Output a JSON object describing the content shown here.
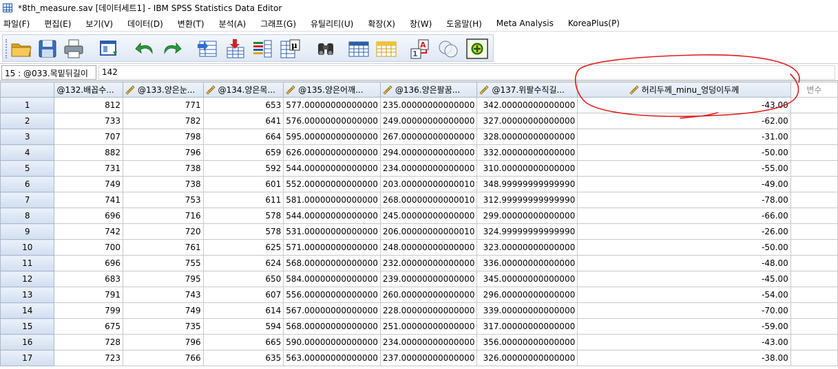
{
  "window": {
    "title": "*8th_measure.sav [데이터세트1] - IBM SPSS Statistics Data Editor"
  },
  "menu": [
    "파일(F)",
    "편집(E)",
    "보기(V)",
    "데이터(D)",
    "변환(T)",
    "분석(A)",
    "그래프(G)",
    "유틸리티(U)",
    "확장(X)",
    "창(W)",
    "도움말(H)",
    "Meta Analysis",
    "KoreaPlus(P)"
  ],
  "toolbar": {
    "icons": [
      "open-folder-icon",
      "save-icon",
      "print-icon",
      "recall-dialog-icon",
      "undo-icon",
      "redo-icon",
      "goto-case-icon",
      "goto-variable-icon",
      "variables-icon",
      "value-labels-mu-icon",
      "find-binoculars-icon",
      "insert-cases-icon",
      "insert-variable-icon",
      "split-file-icon",
      "weight-cases-icon",
      "select-cases-icon",
      "use-sets-icon"
    ]
  },
  "cellbar": {
    "ref": "15 : @033.목밑뒤길이",
    "value": "142"
  },
  "grid": {
    "columns": [
      {
        "label": "@132.배꼽수...",
        "ruler": false
      },
      {
        "label": "@133.양은눈...",
        "ruler": true
      },
      {
        "label": "@134.양은목...",
        "ruler": true
      },
      {
        "label": "@135.양은어깨...",
        "ruler": true
      },
      {
        "label": "@136.양은팔꿈...",
        "ruler": true
      },
      {
        "label": "@137.위팔수직길...",
        "ruler": true
      },
      {
        "label": "허리두께_minu_엉덩이두께",
        "ruler": true
      }
    ],
    "empty_column_label": "변수",
    "rows": [
      {
        "n": "1",
        "c": [
          "812",
          "771",
          "653",
          "577.00000000000000",
          "235.00000000000000",
          "342.00000000000000",
          "-43.00"
        ]
      },
      {
        "n": "2",
        "c": [
          "733",
          "782",
          "641",
          "576.00000000000000",
          "249.00000000000000",
          "327.00000000000000",
          "-62.00"
        ]
      },
      {
        "n": "3",
        "c": [
          "707",
          "798",
          "664",
          "595.00000000000000",
          "267.00000000000000",
          "328.00000000000000",
          "-31.00"
        ]
      },
      {
        "n": "4",
        "c": [
          "882",
          "796",
          "659",
          "626.00000000000000",
          "294.00000000000000",
          "332.00000000000000",
          "-50.00"
        ]
      },
      {
        "n": "5",
        "c": [
          "731",
          "738",
          "592",
          "544.00000000000000",
          "234.00000000000000",
          "310.00000000000000",
          "-55.00"
        ]
      },
      {
        "n": "6",
        "c": [
          "749",
          "738",
          "601",
          "552.00000000000000",
          "203.00000000000010",
          "348.99999999999990",
          "-49.00"
        ]
      },
      {
        "n": "7",
        "c": [
          "741",
          "753",
          "611",
          "581.00000000000000",
          "268.00000000000010",
          "312.99999999999990",
          "-78.00"
        ]
      },
      {
        "n": "8",
        "c": [
          "696",
          "716",
          "578",
          "544.00000000000000",
          "245.00000000000000",
          "299.00000000000000",
          "-66.00"
        ]
      },
      {
        "n": "9",
        "c": [
          "742",
          "720",
          "578",
          "531.00000000000000",
          "206.00000000000010",
          "324.99999999999990",
          "-26.00"
        ]
      },
      {
        "n": "10",
        "c": [
          "700",
          "761",
          "625",
          "571.00000000000000",
          "248.00000000000000",
          "323.00000000000000",
          "-50.00"
        ]
      },
      {
        "n": "11",
        "c": [
          "696",
          "755",
          "624",
          "568.00000000000000",
          "232.00000000000000",
          "336.00000000000000",
          "-48.00"
        ]
      },
      {
        "n": "12",
        "c": [
          "683",
          "795",
          "650",
          "584.00000000000000",
          "239.00000000000000",
          "345.00000000000000",
          "-45.00"
        ]
      },
      {
        "n": "13",
        "c": [
          "791",
          "743",
          "607",
          "556.00000000000000",
          "260.00000000000000",
          "296.00000000000000",
          "-54.00"
        ]
      },
      {
        "n": "14",
        "c": [
          "799",
          "749",
          "614",
          "567.00000000000000",
          "228.00000000000000",
          "339.00000000000000",
          "-70.00"
        ]
      },
      {
        "n": "15",
        "c": [
          "675",
          "735",
          "594",
          "568.00000000000000",
          "251.00000000000000",
          "317.00000000000000",
          "-59.00"
        ]
      },
      {
        "n": "16",
        "c": [
          "728",
          "796",
          "665",
          "590.00000000000000",
          "234.00000000000000",
          "356.00000000000000",
          "-43.00"
        ]
      },
      {
        "n": "17",
        "c": [
          "723",
          "766",
          "635",
          "563.00000000000000",
          "237.00000000000000",
          "326.00000000000000",
          "-38.00"
        ]
      }
    ]
  },
  "colors": {
    "annotation": "#e01b1b",
    "header_bg": "#dbe5f2",
    "grid_line": "#c8c8c8"
  }
}
